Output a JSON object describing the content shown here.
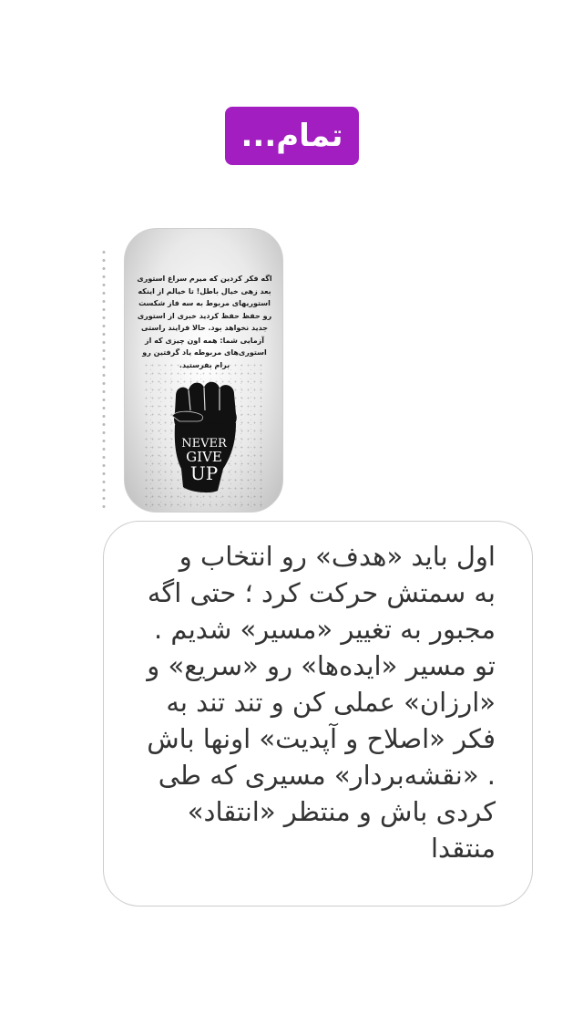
{
  "title_badge": {
    "label": "تمام...",
    "color": "#a21ec0"
  },
  "story_thumbnail": {
    "text": "اگه فکر کردین که میرم سراغ استوری بعد زهی خیال باطل! تا خیالم از اینکه استوریهای مربوط به سه فاز شکست رو حفظ حفظ کردید خبری از استوری جدید نخواهد بود. حالا فرایند راستی آزمایی شما: همه اون چیزی که از استوری‌های مربوطه یاد گرفتین رو برام بفرستید.",
    "poster_lines": [
      "NEVER",
      "GIVE",
      "UP"
    ],
    "icon": "raised-fist-icon"
  },
  "caption": {
    "text": "اول باید «هدف» رو انتخاب و\nبه سمتش حرکت کرد ؛ حتی اگه\nمجبور به تغییر «مسیر» شدیم .\nتو مسیر «ایده‌ها» رو «سریع» و\n«ارزان» عملی کن و تند تند به\nفکر «اصلاح و آپدیت» اونها باش\n. «نقشه‌بردار» مسیری که طی\nکردی باش و منتظر «انتقاد»\nمنتقدا"
  }
}
